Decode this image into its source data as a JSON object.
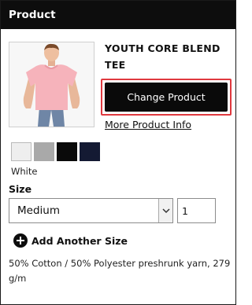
{
  "header": {
    "title": "Product"
  },
  "product": {
    "name": "YOUTH CORE BLEND TEE",
    "change_label": "Change Product",
    "more_info_label": "More Product Info",
    "description": "50% Cotton / 50% Polyester preshrunk yarn, 279 g/m"
  },
  "colors": {
    "selected_name": "White",
    "swatches": [
      {
        "name": "white",
        "hex": "#eeeeee"
      },
      {
        "name": "gray",
        "hex": "#a9a9a9"
      },
      {
        "name": "black",
        "hex": "#0a0a0a"
      },
      {
        "name": "navy",
        "hex": "#141a33"
      }
    ]
  },
  "size": {
    "label": "Size",
    "selected": "Medium",
    "quantity": "1"
  },
  "add_size": {
    "label": "Add Another Size",
    "icon": "plus-circle-icon"
  },
  "accent": {
    "highlight": "#e0393f"
  }
}
